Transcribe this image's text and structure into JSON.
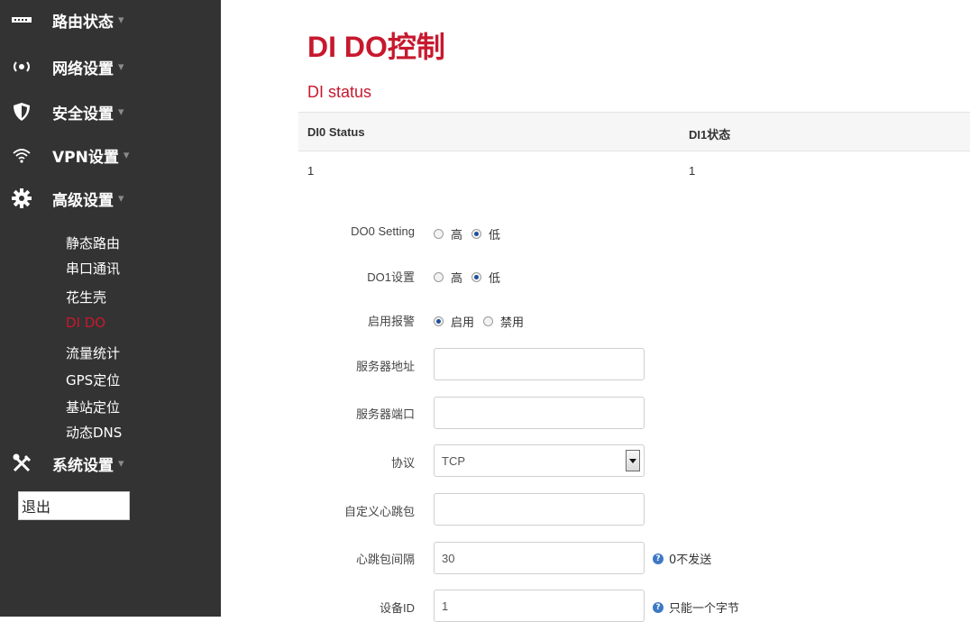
{
  "sidebar": {
    "menu": [
      {
        "label": "路由状态",
        "icon": "router-icon"
      },
      {
        "label": "网络设置",
        "icon": "wireless-icon"
      },
      {
        "label": "安全设置",
        "icon": "shield-icon"
      },
      {
        "label": "VPN设置",
        "icon": "wifi-icon"
      },
      {
        "label": "高级设置",
        "icon": "gear-icon"
      },
      {
        "label": "系统设置",
        "icon": "tools-icon"
      }
    ],
    "caret": "▾",
    "sub_items": [
      "静态路由",
      "串口通讯",
      "花生壳",
      "DI DO",
      "流量统计",
      "GPS定位",
      "基站定位",
      "动态DNS"
    ],
    "active_sub": "DI DO",
    "logout": "退出"
  },
  "page": {
    "title_bold": "DI DO",
    "title_rest": "控制",
    "section_title": "DI status"
  },
  "di_table": {
    "headers": [
      "DI0 Status",
      "DI1状态"
    ],
    "values": [
      "1",
      "1"
    ]
  },
  "form": {
    "do0_label": "DO0 Setting",
    "do1_label": "DO1设置",
    "alarm_label": "启用报警",
    "high": "高",
    "low": "低",
    "enable": "启用",
    "disable": "禁用",
    "server_addr_label": "服务器地址",
    "server_addr_value": "",
    "server_port_label": "服务器端口",
    "server_port_value": "",
    "protocol_label": "协议",
    "protocol_value": "TCP",
    "heartbeat_label": "自定义心跳包",
    "heartbeat_value": "",
    "interval_label": "心跳包间隔",
    "interval_value": "30",
    "interval_help": "0不发送",
    "device_id_label": "设备ID",
    "device_id_value": "1",
    "device_id_help": "只能一个字节"
  },
  "colors": {
    "accent": "#c7192e",
    "sidebar_bg": "#333333"
  }
}
